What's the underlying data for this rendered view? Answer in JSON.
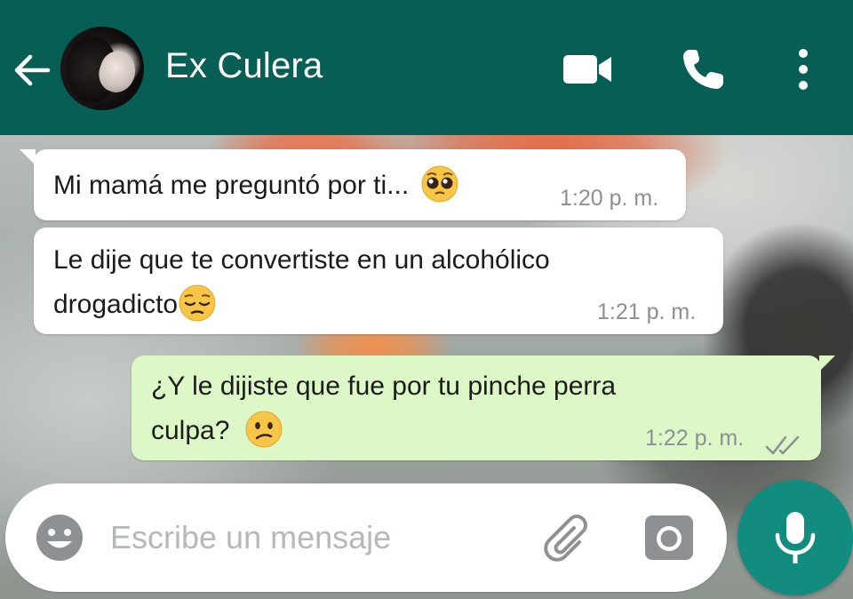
{
  "colors": {
    "header": "#075e54",
    "incoming_bubble": "#ffffff",
    "outgoing_bubble": "#dcf8c6",
    "mic_button": "#128c7e",
    "timestamp": "#8c9094",
    "read_ticks": "#8c9094"
  },
  "header": {
    "contact_name": "Ex Culera",
    "icons": [
      "back-arrow-icon",
      "avatar",
      "video-call-icon",
      "phone-icon",
      "more-vert-icon"
    ]
  },
  "messages": [
    {
      "direction": "incoming",
      "text": "Mi mamá me preguntó por ti...",
      "emoji": "pleading-face",
      "time": "1:20 p. m."
    },
    {
      "direction": "incoming",
      "text_line1": "Le dije que te convertiste en un alcohólico",
      "text_line2": "drogadicto",
      "emoji": "pensive-face",
      "time": "1:21 p. m."
    },
    {
      "direction": "outgoing",
      "text_line1": "¿Y le dijiste que fue por tu pinche perra",
      "text_line2": "culpa?",
      "emoji": "confused-face",
      "time": "1:22 p. m.",
      "status": "read-double-check"
    }
  ],
  "composer": {
    "placeholder": "Escribe un mensaje",
    "value": "",
    "icons": [
      "emoji-icon",
      "attach-icon",
      "camera-icon",
      "mic-icon"
    ]
  }
}
